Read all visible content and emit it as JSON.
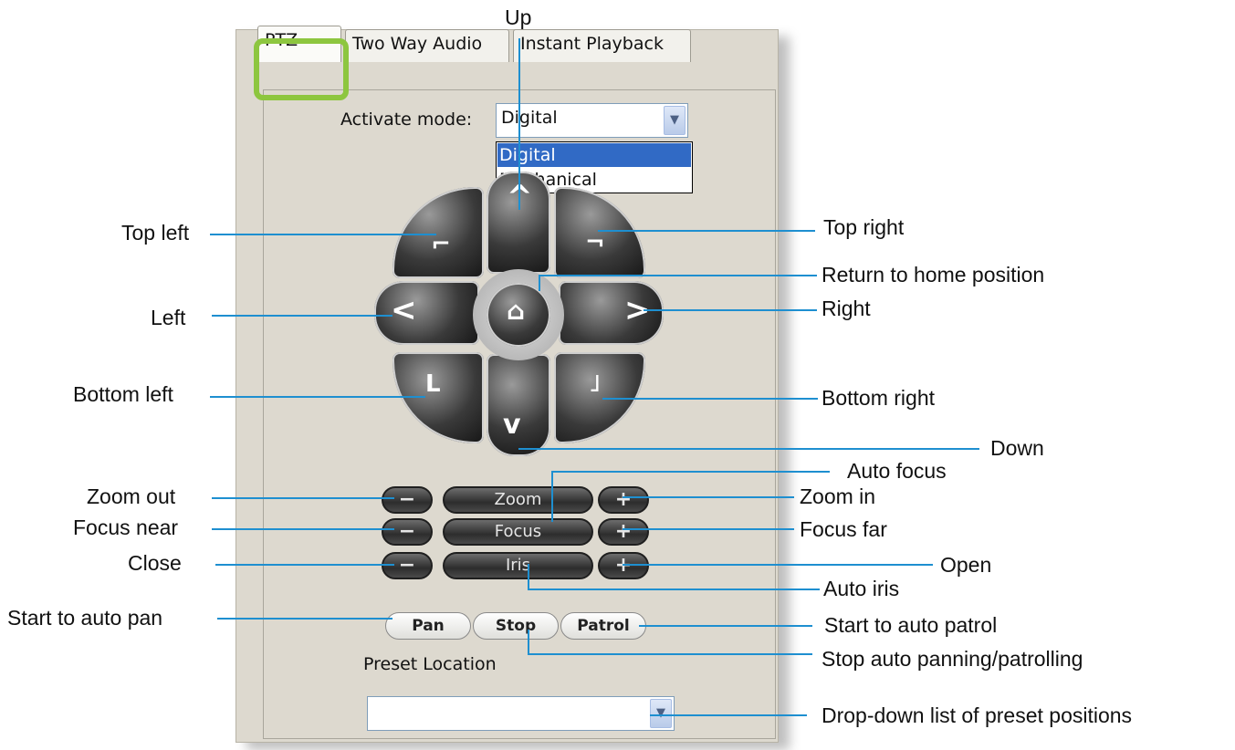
{
  "tabs": [
    "PTZ",
    "Two Way Audio",
    "Instant Playback"
  ],
  "activate_mode": {
    "label": "Activate mode:",
    "value": "Digital",
    "options": [
      "Digital",
      "Mechanical"
    ]
  },
  "controls": {
    "zoom": "Zoom",
    "focus": "Focus",
    "iris": "Iris",
    "minus": "−",
    "plus": "+"
  },
  "buttons": {
    "pan": "Pan",
    "stop": "Stop",
    "patrol": "Patrol"
  },
  "preset": {
    "label": "Preset Location",
    "value": ""
  },
  "callouts": {
    "up": "Up",
    "top_left": "Top left",
    "top_right": "Top right",
    "home": "Return to home position",
    "left": "Left",
    "right": "Right",
    "bottom_left": "Bottom left",
    "bottom_right": "Bottom right",
    "down": "Down",
    "auto_focus": "Auto focus",
    "zoom_out": "Zoom out",
    "zoom_in": "Zoom in",
    "focus_near": "Focus near",
    "focus_far": "Focus far",
    "close": "Close",
    "open": "Open",
    "auto_iris": "Auto iris",
    "auto_pan": "Start to auto pan",
    "auto_patrol": "Start to auto patrol",
    "stop_auto": "Stop auto panning/patrolling",
    "preset_list": "Drop-down list of preset positions"
  },
  "colors": {
    "accent_green": "#8dc63f",
    "callout_line": "#1e8fd0",
    "selection": "#316ac5"
  }
}
